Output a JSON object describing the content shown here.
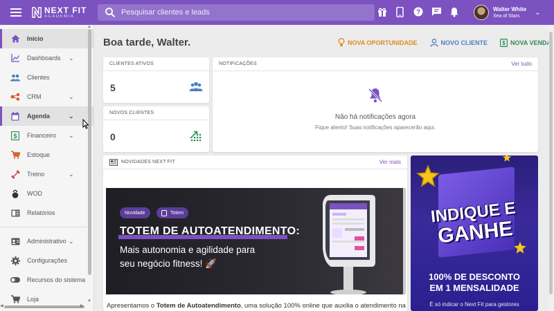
{
  "topbar": {
    "logo_line1": "NEXT FIT",
    "logo_line2": "ACADEMIA",
    "search_placeholder": "Pesquisar clientes e leads",
    "user_name": "Walter White",
    "user_sub": "Sea of Stars",
    "icons": [
      "gift-icon",
      "mobile-icon",
      "help-icon",
      "chat-icon",
      "bell-icon"
    ]
  },
  "sidebar": {
    "items": [
      {
        "label": "Início",
        "icon": "home-icon",
        "chevron": false,
        "active": true
      },
      {
        "label": "Dashboards",
        "icon": "chart-icon",
        "chevron": true
      },
      {
        "label": "Clientes",
        "icon": "people-icon",
        "chevron": false
      },
      {
        "label": "CRM",
        "icon": "crm-icon",
        "chevron": true
      },
      {
        "label": "Agenda",
        "icon": "calendar-icon",
        "chevron": true,
        "hover": true
      },
      {
        "label": "Financeiro",
        "icon": "money-icon",
        "chevron": true
      },
      {
        "label": "Estoque",
        "icon": "cart-icon",
        "chevron": false
      },
      {
        "label": "Treino",
        "icon": "dumbbell-icon",
        "chevron": true
      },
      {
        "label": "WOD",
        "icon": "kettlebell-icon",
        "chevron": false
      },
      {
        "label": "Relatórios",
        "icon": "report-icon",
        "chevron": false
      }
    ],
    "items2": [
      {
        "label": "Administrativo",
        "icon": "admin-icon",
        "chevron": true
      },
      {
        "label": "Configurações",
        "icon": "gear-icon",
        "chevron": false
      },
      {
        "label": "Recursos do sistema",
        "icon": "toggle-icon",
        "chevron": false
      },
      {
        "label": "Loja",
        "icon": "cart-icon",
        "chevron": false
      }
    ]
  },
  "main": {
    "greeting": "Boa tarde, Walter.",
    "actions": {
      "opportunity": "NOVA OPORTUNIDADE",
      "client": "NOVO CLIENTE",
      "sale": "NOVA VENDA"
    },
    "active_clients": {
      "title": "CLIENTES ATIVOS",
      "value": "5"
    },
    "new_clients": {
      "title": "NOVOS CLIENTES",
      "value": "0"
    },
    "notifications": {
      "title": "NOTIFICAÇÕES",
      "link": "Ver tudo",
      "empty_title": "Não há notificações agora",
      "empty_sub": "Fique atento! Suas notificações aparecerão aqui."
    },
    "news": {
      "title": "NOVIDADES NEXT FIT",
      "link": "Ver mais",
      "pill1": "Novidade",
      "pill2": "Totem",
      "headline": "TOTEM DE AUTOATENDIMENTO:",
      "sub_line1": "Mais autonomia e agilidade para",
      "sub_line2": "seu negócio fitness! 🚀",
      "text_prefix": "Apresentamos o ",
      "text_bold": "Totem de Autoatendimento",
      "text_suffix": ", uma solução 100% online que auxilia o atendimento na"
    },
    "promo": {
      "line1": "INDIQUE E",
      "line2": "GANHE",
      "off1": "100% DE DESCONTO",
      "off2": "EM 1 MENSALIDADE",
      "foot": "É só indicar o Next Fit para gestores"
    }
  },
  "colors": {
    "brand": "#7b52c0",
    "opportunity": "#e08a1e",
    "client": "#4a7fc4",
    "sale": "#2e8b57"
  }
}
